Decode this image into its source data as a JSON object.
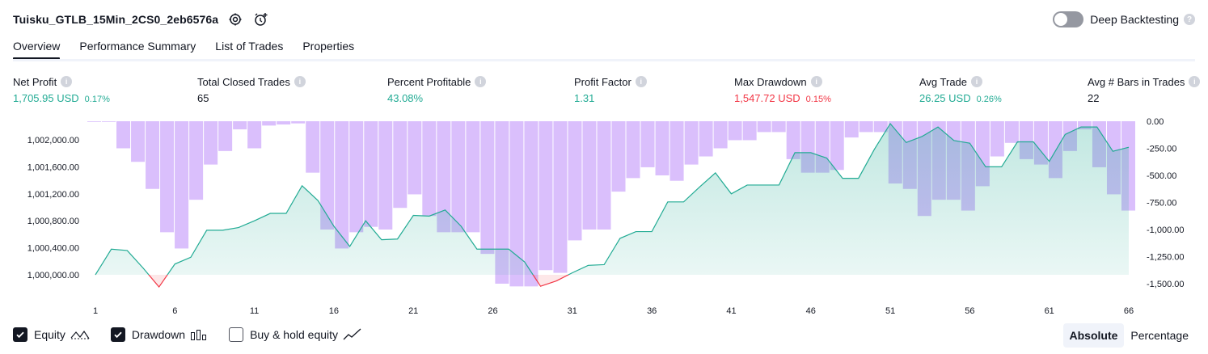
{
  "header": {
    "strategy_name": "Tuisku_GTLB_15Min_2CS0_2eb6576a",
    "settings_icon": "settings-gear-icon",
    "alert_icon": "add-alert-clock-icon",
    "deep_backtesting_label": "Deep Backtesting",
    "deep_backtesting_enabled": false,
    "help_glyph": "?"
  },
  "tabs": [
    {
      "label": "Overview",
      "active": true
    },
    {
      "label": "Performance Summary",
      "active": false
    },
    {
      "label": "List of Trades",
      "active": false
    },
    {
      "label": "Properties",
      "active": false
    }
  ],
  "metrics": {
    "net_profit": {
      "label": "Net Profit",
      "value": "1,705.95 USD",
      "pct": "0.17%"
    },
    "total_closed_trades": {
      "label": "Total Closed Trades",
      "value": "65"
    },
    "percent_profitable": {
      "label": "Percent Profitable",
      "value": "43.08%"
    },
    "profit_factor": {
      "label": "Profit Factor",
      "value": "1.31"
    },
    "max_drawdown": {
      "label": "Max Drawdown",
      "value": "1,547.72 USD",
      "pct": "0.15%"
    },
    "avg_trade": {
      "label": "Avg Trade",
      "value": "26.25 USD",
      "pct": "0.26%"
    },
    "avg_bars": {
      "label": "Avg # Bars in Trades",
      "value": "22"
    },
    "info_glyph": "i"
  },
  "chart_data": {
    "type": "line",
    "series": [
      {
        "name": "Equity",
        "axis": "left",
        "color": "#22ab94",
        "x": [
          1,
          2,
          3,
          4,
          5,
          6,
          7,
          8,
          9,
          10,
          11,
          12,
          13,
          14,
          15,
          16,
          17,
          18,
          19,
          20,
          21,
          22,
          23,
          24,
          25,
          26,
          27,
          28,
          29,
          30,
          31,
          32,
          33,
          34,
          35,
          36,
          37,
          38,
          39,
          40,
          41,
          42,
          43,
          44,
          45,
          46,
          47,
          48,
          49,
          50,
          51,
          52,
          53,
          54,
          55,
          56,
          57,
          58,
          59,
          60,
          61,
          62,
          63,
          64,
          65,
          66
        ],
        "values": [
          1000000,
          1000380,
          1000360,
          1000100,
          999820,
          1000160,
          1000260,
          1000660,
          1000660,
          1000700,
          1000800,
          1000910,
          1000910,
          1001320,
          1001100,
          1000720,
          1000420,
          1000800,
          1000520,
          1000530,
          1000880,
          1000870,
          1000960,
          1000720,
          1000380,
          1000380,
          1000380,
          1000190,
          999830,
          999910,
          1000030,
          1000140,
          1000150,
          1000540,
          1000640,
          1000640,
          1001080,
          1001080,
          1001300,
          1001510,
          1001200,
          1001330,
          1001330,
          1001330,
          1001810,
          1001810,
          1001730,
          1001430,
          1001430,
          1001860,
          1002240,
          1001960,
          1002050,
          1002190,
          1001990,
          1001950,
          1001600,
          1001600,
          1001970,
          1001970,
          1001680,
          1002080,
          1002190,
          1002190,
          1001830,
          1001890
        ]
      },
      {
        "name": "Drawdown",
        "axis": "right",
        "color": "#d1b2fb",
        "type": "bar",
        "values": [
          0,
          -5,
          -250,
          -375,
          -625,
          -1025,
          -1175,
          -725,
          -400,
          -275,
          -75,
          -250,
          -40,
          -30,
          -20,
          -475,
          -1000,
          -1175,
          -1025,
          -975,
          -1000,
          -800,
          -675,
          -875,
          -1025,
          -1025,
          -1025,
          -1225,
          -1500,
          -1525,
          -1525,
          -1375,
          -1400,
          -1100,
          -1000,
          -1000,
          -650,
          -525,
          -425,
          -500,
          -550,
          -400,
          -325,
          -250,
          -175,
          -175,
          -100,
          -100,
          -350,
          -475,
          -475,
          -450,
          -150,
          -100,
          -100,
          -575,
          -625,
          -875,
          -725,
          -725,
          -825,
          -600,
          -325,
          -200,
          -350,
          -400,
          -525,
          -275,
          -75,
          -425,
          -675,
          -825
        ]
      }
    ],
    "x_ticks": [
      1,
      6,
      11,
      16,
      21,
      26,
      31,
      36,
      41,
      46,
      51,
      56,
      61,
      66
    ],
    "left_axis": {
      "ticks": [
        "1,000,000.00",
        "1,000,400.00",
        "1,000,800.00",
        "1,001,200.00",
        "1,001,600.00",
        "1,002,000.00"
      ],
      "ylim": [
        999750,
        2002280
      ]
    },
    "right_axis": {
      "ticks": [
        "0.00",
        "-250.00",
        "-500.00",
        "-750.00",
        "-1,000.00",
        "-1,250.00",
        "-1,500.00"
      ],
      "ylim": [
        -1580,
        0
      ]
    },
    "grid": false
  },
  "legend": {
    "equity": {
      "label": "Equity",
      "checked": true,
      "icon": "equity-line-icon"
    },
    "drawdown": {
      "label": "Drawdown",
      "checked": true,
      "icon": "drawdown-bars-icon"
    },
    "buy_hold": {
      "label": "Buy & hold equity",
      "checked": false,
      "icon": "buy-hold-line-icon"
    }
  },
  "view_mode": {
    "absolute_label": "Absolute",
    "percentage_label": "Percentage",
    "selected": "Absolute"
  }
}
